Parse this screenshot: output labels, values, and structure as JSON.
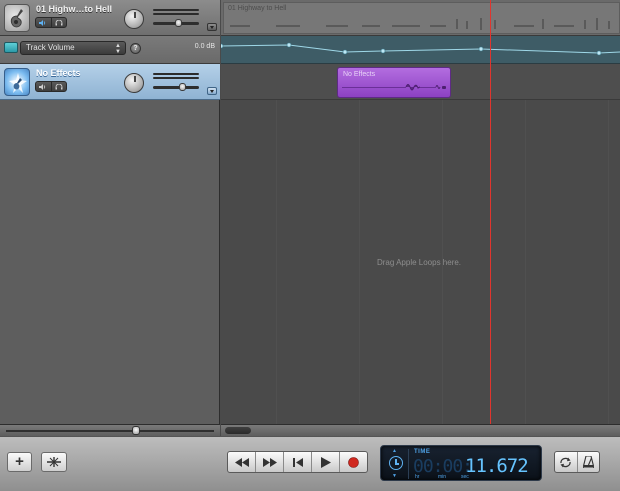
{
  "tracks": [
    {
      "name": "01 Highw…to Hell",
      "icon": "guitar-icon",
      "volume_level": 0.55
    },
    {
      "name": "No Effects",
      "icon": "star-burst-icon",
      "volume_level": 0.62
    }
  ],
  "automation": {
    "parameter": "Track Volume",
    "level_label": "0.0 dB",
    "accent_color": "#5fd0d8"
  },
  "timeline": {
    "region_ghost_label": "01 Highway to Hell",
    "region_label": "No Effects",
    "drop_hint": "Drag Apple Loops here.",
    "region_color": "#a35ad8",
    "playhead_color": "#e0352e"
  },
  "lcd": {
    "mode_label": "TIME",
    "dim_digits": "00:00:",
    "value": "11.672",
    "units": [
      "hr",
      "min",
      "sec"
    ]
  },
  "toolbar": {
    "add_track": "+",
    "transport": [
      "rewind",
      "fast-forward",
      "go-to-start",
      "play",
      "record"
    ],
    "right_buttons": [
      "cycle",
      "metronome"
    ]
  }
}
